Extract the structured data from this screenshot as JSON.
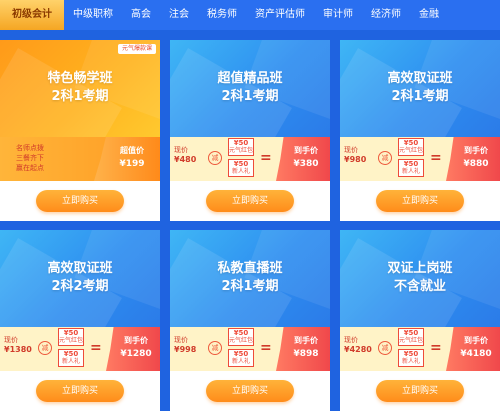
{
  "tabs": [
    {
      "label": "初级会计",
      "active": true
    },
    {
      "label": "中级职称"
    },
    {
      "label": "高会"
    },
    {
      "label": "注会"
    },
    {
      "label": "税务师"
    },
    {
      "label": "资产评估师"
    },
    {
      "label": "审计师"
    },
    {
      "label": "经济师"
    },
    {
      "label": "金融"
    }
  ],
  "cards": [
    {
      "title_line1": "特色畅学班",
      "title_line2": "2科1考期",
      "badge": "元气爆款课",
      "special_text": [
        "名师点拨",
        "三餐齐下",
        "赢在起点"
      ],
      "final_label": "超值价",
      "final_price": "¥199",
      "buy": "立即购买"
    },
    {
      "title_line1": "超值精品班",
      "title_line2": "2科1考期",
      "orig_label": "现价",
      "orig_price": "¥480",
      "minus": "减",
      "coupon1_amt": "¥50",
      "coupon1_txt": "元气红包",
      "coupon2_amt": "¥50",
      "coupon2_txt": "新人礼",
      "eq": "=",
      "final_label": "到手价",
      "final_price": "¥380",
      "buy": "立即购买"
    },
    {
      "title_line1": "高效取证班",
      "title_line2": "2科1考期",
      "orig_label": "现价",
      "orig_price": "¥980",
      "minus": "减",
      "coupon1_amt": "¥50",
      "coupon1_txt": "元气红包",
      "coupon2_amt": "¥50",
      "coupon2_txt": "新人礼",
      "eq": "=",
      "final_label": "到手价",
      "final_price": "¥880",
      "buy": "立即购买"
    },
    {
      "title_line1": "高效取证班",
      "title_line2": "2科2考期",
      "orig_label": "现价",
      "orig_price": "¥1380",
      "minus": "减",
      "coupon1_amt": "¥50",
      "coupon1_txt": "元气红包",
      "coupon2_amt": "¥50",
      "coupon2_txt": "新人礼",
      "eq": "=",
      "final_label": "到手价",
      "final_price": "¥1280",
      "buy": "立即购买"
    },
    {
      "title_line1": "私教直播班",
      "title_line2": "2科1考期",
      "orig_label": "现价",
      "orig_price": "¥998",
      "minus": "减",
      "coupon1_amt": "¥50",
      "coupon1_txt": "元气红包",
      "coupon2_amt": "¥50",
      "coupon2_txt": "新人礼",
      "eq": "=",
      "final_label": "到手价",
      "final_price": "¥898",
      "buy": "立即购买"
    },
    {
      "title_line1": "双证上岗班",
      "title_line2": "不含就业",
      "orig_label": "现价",
      "orig_price": "¥4280",
      "minus": "减",
      "coupon1_amt": "¥50",
      "coupon1_txt": "元气红包",
      "coupon2_amt": "¥50",
      "coupon2_txt": "新人礼",
      "eq": "=",
      "final_label": "到手价",
      "final_price": "¥4180",
      "buy": "立即购买"
    }
  ],
  "colors": {
    "tab_bar": "#2a6ff0",
    "active_tab": "#f5a623",
    "card_blue": "#2e8ef0",
    "card_orange": "#ffb21e",
    "price_red": "#d13b2a",
    "buy_button": "#ff8c1a"
  }
}
